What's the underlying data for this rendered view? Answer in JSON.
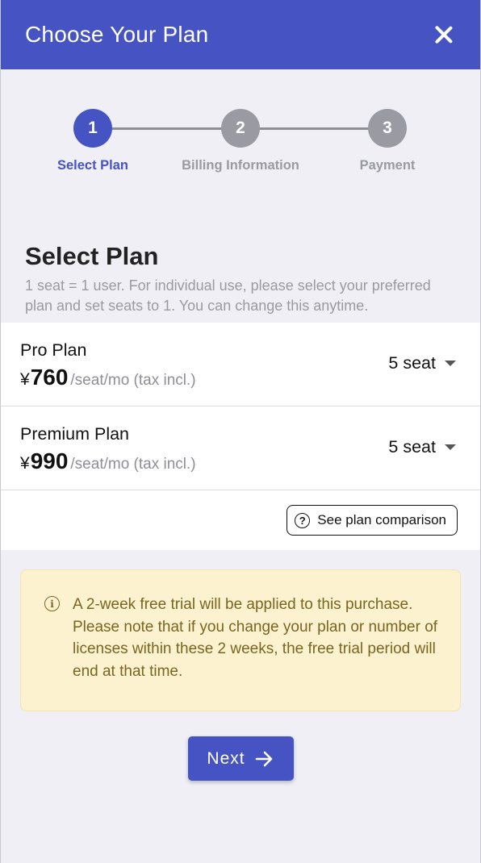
{
  "header": {
    "title": "Choose Your Plan",
    "close_icon": "close-icon"
  },
  "stepper": {
    "steps": [
      {
        "number": "1",
        "label": "Select Plan",
        "active": true
      },
      {
        "number": "2",
        "label": "Billing Information",
        "active": false
      },
      {
        "number": "3",
        "label": "Payment",
        "active": false
      }
    ]
  },
  "select_plan": {
    "title": "Select Plan",
    "description": "1 seat = 1 user. For individual use, please select your preferred plan and set seats to 1. You can change this anytime."
  },
  "plans": [
    {
      "name": "Pro Plan",
      "currency": "¥",
      "price": "760",
      "unit": "/seat/mo (tax incl.)",
      "seats": "5 seat"
    },
    {
      "name": "Premium Plan",
      "currency": "¥",
      "price": "990",
      "unit": "/seat/mo (tax incl.)",
      "seats": "5 seat"
    }
  ],
  "comparison": {
    "label": "See plan comparison",
    "icon": "help-icon"
  },
  "notice": {
    "icon": "info-icon",
    "text": "A 2-week free trial will be applied to this purchase. Please note that if you change your plan or number of licenses within these 2 weeks, the free trial period will end at that time."
  },
  "next_button": {
    "label": "Next",
    "icon": "arrow-right-icon"
  },
  "colors": {
    "primary": "#4653c2",
    "inactive_step": "#9a9aa2",
    "notice_bg": "#fdf2cf",
    "notice_text": "#7a6520",
    "page_bg": "#efeff5"
  }
}
